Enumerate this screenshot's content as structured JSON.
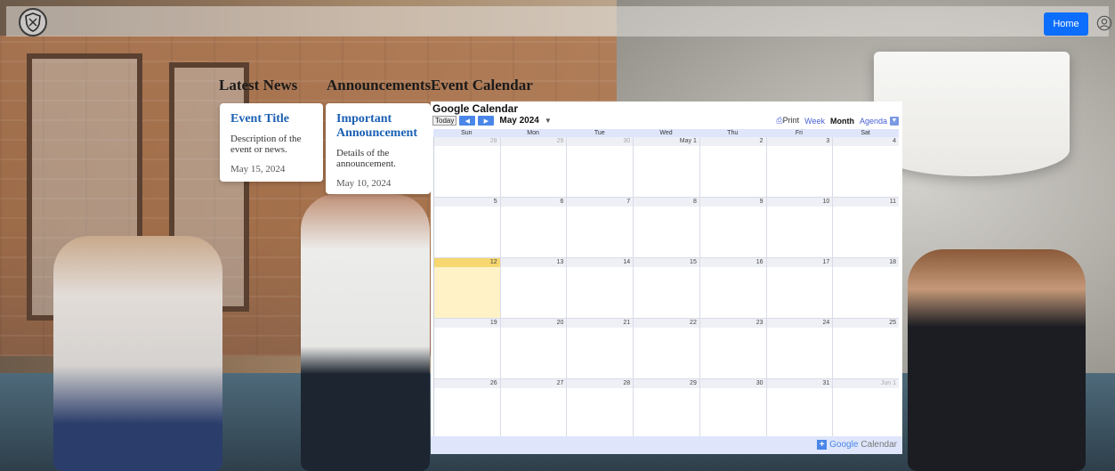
{
  "header": {
    "home_label": "Home"
  },
  "sections": {
    "latest_news": "Latest News",
    "announcements": "Announcements",
    "event_calendar": "Event Calendar"
  },
  "news_card": {
    "title": "Event Title",
    "description": "Description of the event or news.",
    "date": "May 15, 2024"
  },
  "announcement_card": {
    "title": "Important Announcement",
    "description": "Details of the announcement.",
    "date": "May 10, 2024"
  },
  "calendar": {
    "title": "Google Calendar",
    "today_label": "Today",
    "month_label": "May 2024",
    "print_label": "Print",
    "views": [
      "Week",
      "Month",
      "Agenda"
    ],
    "active_view": "Month",
    "weekdays": [
      "Sun",
      "Mon",
      "Tue",
      "Wed",
      "Thu",
      "Fri",
      "Sat"
    ],
    "weeks": [
      [
        "28",
        "29",
        "30",
        "May 1",
        "2",
        "3",
        "4"
      ],
      [
        "5",
        "6",
        "7",
        "8",
        "9",
        "10",
        "11"
      ],
      [
        "12",
        "13",
        "14",
        "15",
        "16",
        "17",
        "18"
      ],
      [
        "19",
        "20",
        "21",
        "22",
        "23",
        "24",
        "25"
      ],
      [
        "26",
        "27",
        "28",
        "29",
        "30",
        "31",
        "Jun 1"
      ]
    ],
    "today": "12",
    "footer_brand_prefix": "Google",
    "footer_brand_suffix": "Calendar"
  }
}
